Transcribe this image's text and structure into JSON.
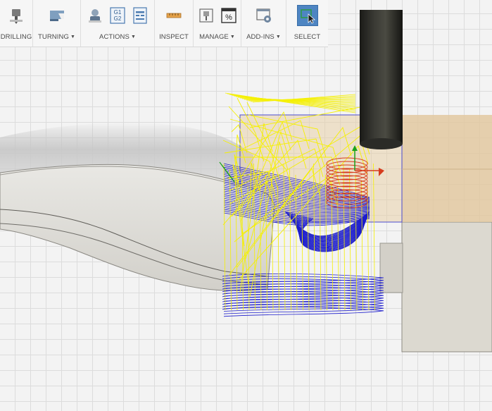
{
  "toolbar": {
    "groups": [
      {
        "id": "drilling",
        "label": "DRILLING",
        "dropdown": false,
        "icons": [
          "drill-icon"
        ]
      },
      {
        "id": "turning",
        "label": "TURNING",
        "dropdown": true,
        "icons": [
          "turning-tool-icon"
        ]
      },
      {
        "id": "actions",
        "label": "ACTIONS",
        "dropdown": true,
        "icons": [
          "simulate-icon",
          "post-process-g1g2-icon",
          "setup-sheet-icon"
        ]
      },
      {
        "id": "inspect",
        "label": "INSPECT",
        "dropdown": false,
        "icons": [
          "measure-ruler-icon"
        ]
      },
      {
        "id": "manage",
        "label": "MANAGE",
        "dropdown": true,
        "icons": [
          "tool-library-icon",
          "post-library-percent-icon"
        ]
      },
      {
        "id": "addins",
        "label": "ADD-INS",
        "dropdown": true,
        "icons": [
          "scripts-addins-icon"
        ]
      },
      {
        "id": "select",
        "label": "SELECT",
        "dropdown": false,
        "active": true,
        "icons": [
          "select-cursor-icon"
        ]
      }
    ],
    "icon_text": {
      "g1": "G1",
      "g2": "G2",
      "percent": "%"
    }
  },
  "viewport": {
    "background_color": "#f3f3f3",
    "grid_color": "#dcdcdc",
    "stock_color": "#e7cfa8",
    "part_color": "#e2e1dc",
    "fixture_color": "#dcd9d0",
    "toolpath_colors": {
      "rapid": "#f5f000",
      "cutting": "#1d1dcc",
      "helix": "#d63b1d",
      "lead": "#1aa31a"
    },
    "tool_color": "#2a2a26"
  }
}
